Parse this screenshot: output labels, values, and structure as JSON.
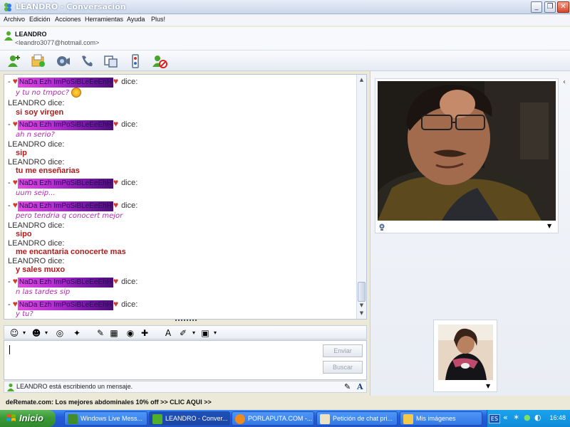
{
  "window": {
    "title": "LEANDRO - Conversación"
  },
  "menu": [
    "Archivo",
    "Edición",
    "Acciones",
    "Herramientas",
    "Ayuda",
    "Plus!"
  ],
  "contact": {
    "name": "LEANDRO",
    "email": "<leandro3077@hotmail.com>"
  },
  "chat": {
    "nick": "NaDa Ezh ImPoSiBLeEeEhH",
    "dice": "dice:",
    "leandro_dice": "LEANDRO dice:",
    "messages": {
      "m1": "y tu no tmpoc?",
      "m2": "si soy virgen",
      "m3": "ah n serio?",
      "m4": "sip",
      "m5": "tu me enseñarias",
      "m6": "uum seip...",
      "m7": "pero tendria q conocert mejor",
      "m8": "sipo",
      "m9": "me encantaria conocerte mas",
      "m10": "y sales muxo",
      "m11": "n las tardes sip",
      "m12": "y tu?"
    }
  },
  "input": {
    "send_label": "Enviar",
    "search_label": "Buscar"
  },
  "status": {
    "text": "LEANDRO está escribiendo un mensaje."
  },
  "ad": {
    "text": "deRemate.com: Los mejores abdominales 10% off >> CLIC AQUI >>"
  },
  "taskbar": {
    "start_label": "Inicio",
    "tasks": [
      "Windows Live Mess...",
      "LEANDRO - Conver...",
      "PORLAPUTA.COM -...",
      "Petición de chat pri...",
      "Mis imágenes"
    ],
    "lang": "ES",
    "clock": "16:48"
  }
}
